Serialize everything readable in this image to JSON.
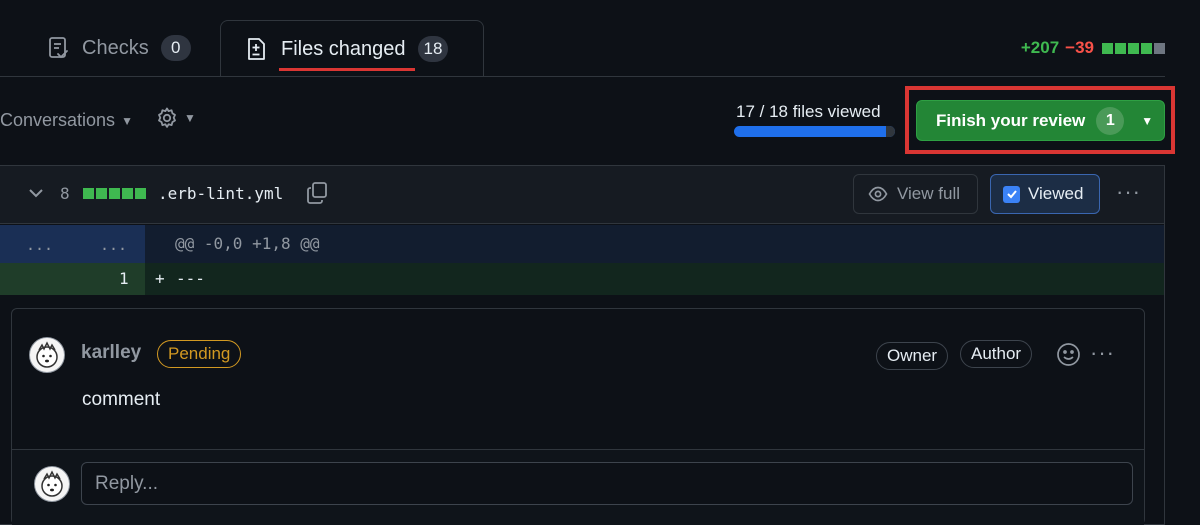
{
  "tabs": {
    "checks": {
      "label": "Checks",
      "count": "0"
    },
    "files": {
      "label": "Files changed",
      "count": "18"
    }
  },
  "diffstat": {
    "additions": "+207",
    "deletions": "−39"
  },
  "toolbar": {
    "conversations_label": "Conversations",
    "files_viewed": "17 / 18 files viewed",
    "files_viewed_fraction": 0.944,
    "finish_review_label": "Finish your review",
    "finish_review_count": "1"
  },
  "file": {
    "change_count": "8",
    "name": ".erb-lint.yml",
    "view_full_label": "View full",
    "viewed_label": "Viewed"
  },
  "diff": {
    "hunk_old_gutter": "...",
    "hunk_new_gutter": "...",
    "hunk_header": "@@ -0,0 +1,8 @@",
    "add_line_number": "1",
    "add_line_marker": "+",
    "add_line_code": "---"
  },
  "comment": {
    "author": "karlley",
    "status": "Pending",
    "badge_owner": "Owner",
    "badge_author": "Author",
    "body": "comment",
    "reply_placeholder": "Reply..."
  },
  "colors": {
    "accent_green": "#238636",
    "addition_green": "#3fb950",
    "deletion_red": "#f85149",
    "highlight_red": "#da3633",
    "pending_orange": "#d29922",
    "progress_blue": "#1f6feb"
  }
}
